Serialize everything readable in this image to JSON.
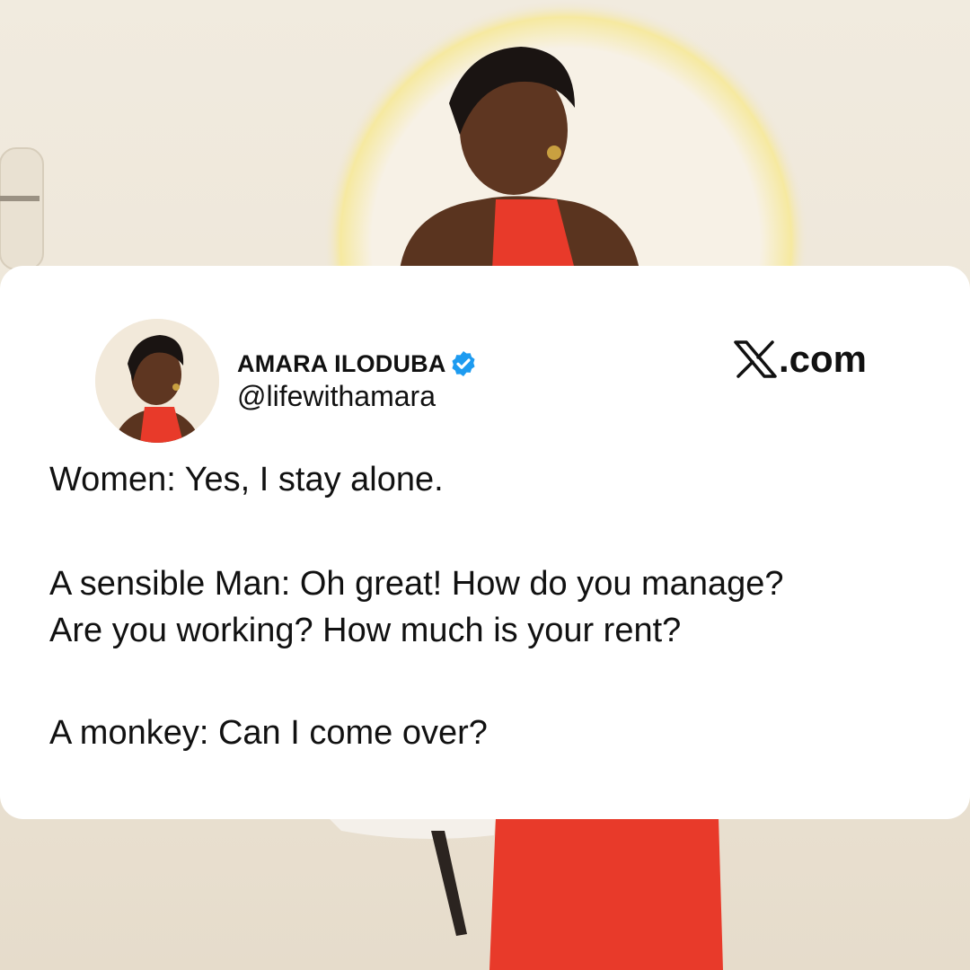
{
  "tweet": {
    "display_name": "AMARA ILODUBA",
    "handle": "@lifewithamara",
    "verified": true,
    "body": {
      "line1": "Women: Yes, I stay alone.",
      "line2": "A sensible Man: Oh great! How do you manage?",
      "line3": "Are you working? How much is your rent?",
      "line4": "A monkey: Can I come over?"
    }
  },
  "brand": {
    "text": ".com",
    "icon": "x-logo-icon"
  },
  "colors": {
    "card": "#ffffff",
    "text": "#111111",
    "verified": "#1d9bf0",
    "dress": "#e83a2a",
    "background": "#efe7da"
  }
}
